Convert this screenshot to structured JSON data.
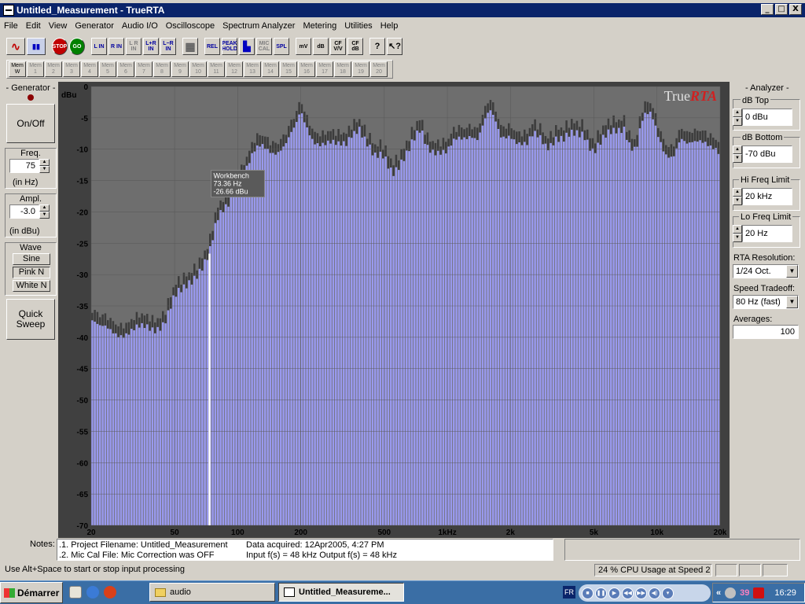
{
  "window": {
    "title": "Untitled_Measurement - TrueRTA",
    "controls": [
      "_",
      "□",
      "X"
    ]
  },
  "menu": [
    "File",
    "Edit",
    "View",
    "Generator",
    "Audio I/O",
    "Oscilloscope",
    "Spectrum Analyzer",
    "Metering",
    "Utilities",
    "Help"
  ],
  "toolbar": {
    "buttons": [
      {
        "name": "generator-wave-button",
        "label": "∿"
      },
      {
        "name": "spectrum-view-button",
        "label": "▮▮"
      },
      {
        "name": "stop-button",
        "label": "STOP"
      },
      {
        "name": "go-button",
        "label": "GO"
      },
      {
        "name": "l-in-button",
        "label": "L IN"
      },
      {
        "name": "r-in-button",
        "label": "R IN"
      },
      {
        "name": "l-r-in-button",
        "label": "L R IN"
      },
      {
        "name": "l-plus-r-in-button",
        "label": "L+R IN"
      },
      {
        "name": "l-minus-r-in-button",
        "label": "L−R IN"
      },
      {
        "name": "grid-button",
        "label": "▦"
      },
      {
        "name": "rel-button",
        "label": "REL"
      },
      {
        "name": "peak-hold-button",
        "label": "PEAK HOLD"
      },
      {
        "name": "bars-button",
        "label": "▙"
      },
      {
        "name": "mic-cal-button",
        "label": "MIC CAL"
      },
      {
        "name": "spl-button",
        "label": "SPL"
      },
      {
        "name": "mv-button",
        "label": "mV"
      },
      {
        "name": "db-button",
        "label": "dB"
      },
      {
        "name": "cf-vv-button",
        "label": "CF V/V"
      },
      {
        "name": "cf-db-button",
        "label": "CF dB"
      },
      {
        "name": "help-button",
        "label": "?"
      },
      {
        "name": "context-help-button",
        "label": "↖?"
      }
    ],
    "memories": [
      "Mem W",
      "Mem 1",
      "Mem 2",
      "Mem 3",
      "Mem 4",
      "Mem 5",
      "Mem 6",
      "Mem 7",
      "Mem 8",
      "Mem 9",
      "Mem 10",
      "Mem 11",
      "Mem 12",
      "Mem 13",
      "Mem 14",
      "Mem 15",
      "Mem 16",
      "Mem 17",
      "Mem 18",
      "Mem 19",
      "Mem 20"
    ]
  },
  "generator": {
    "title": "- Generator -",
    "on_off": "On/Off",
    "freq_label": "Freq.",
    "freq_value": "75",
    "freq_unit": "(in Hz)",
    "ampl_label": "Ampl.",
    "ampl_value": "-3.0",
    "ampl_unit": "(in dBu)",
    "wave_label": "Wave",
    "waves": [
      "Sine",
      "Pink N",
      "White N"
    ],
    "selected_wave": "Pink N",
    "quick_sweep": "Quick Sweep"
  },
  "analyzer": {
    "title": "- Analyzer -",
    "db_top_label": "dB Top",
    "db_top": "0 dBu",
    "db_bottom_label": "dB Bottom",
    "db_bottom": "-70 dBu",
    "hi_freq_label": "Hi Freq Limit",
    "hi_freq": "20 kHz",
    "lo_freq_label": "Lo Freq Limit",
    "lo_freq": "20 Hz",
    "resolution_label": "RTA Resolution:",
    "resolution": "1/24 Oct.",
    "speed_label": "Speed Tradeoff:",
    "speed": "80 Hz (fast)",
    "averages_label": "Averages:",
    "averages": "100"
  },
  "chart_data": {
    "type": "bar",
    "brand": "TrueRTA",
    "ylabel": "dBu",
    "ylim": [
      -70,
      0
    ],
    "yticks": [
      "0",
      "-5",
      "-10",
      "-15",
      "-20",
      "-25",
      "-30",
      "-35",
      "-40",
      "-45",
      "-50",
      "-55",
      "-60",
      "-65",
      "-70"
    ],
    "xscale": "log",
    "xlim": [
      20,
      20000
    ],
    "xticks": [
      {
        "v": 20,
        "label": "20"
      },
      {
        "v": 50,
        "label": "50"
      },
      {
        "v": 100,
        "label": "100"
      },
      {
        "v": 200,
        "label": "200"
      },
      {
        "v": 500,
        "label": "500"
      },
      {
        "v": 1000,
        "label": "1kHz"
      },
      {
        "v": 2000,
        "label": "2k"
      },
      {
        "v": 5000,
        "label": "5k"
      },
      {
        "v": 10000,
        "label": "10k"
      },
      {
        "v": 20000,
        "label": "20k"
      }
    ],
    "bar_color": "#9999ee",
    "peak_color": "#3c3c3c",
    "background": "#6e6e6e",
    "cursor": {
      "freq": 73.36,
      "series": "Workbench",
      "freq_label": "73.36 Hz",
      "level_label": "-26.66 dBu",
      "level": -26.66
    },
    "series": [
      {
        "name": "Workbench",
        "spectrum": [
          [
            20,
            -37
          ],
          [
            22,
            -39
          ],
          [
            25,
            -39
          ],
          [
            30,
            -39
          ],
          [
            35,
            -39
          ],
          [
            40,
            -38.5
          ],
          [
            45,
            -37
          ],
          [
            50,
            -34
          ],
          [
            55,
            -33
          ],
          [
            60,
            -31
          ],
          [
            65,
            -29
          ],
          [
            70,
            -27.5
          ],
          [
            73.36,
            -26.66
          ],
          [
            80,
            -22
          ],
          [
            90,
            -19
          ],
          [
            100,
            -15
          ],
          [
            110,
            -13
          ],
          [
            120,
            -11
          ],
          [
            130,
            -10
          ],
          [
            150,
            -10
          ],
          [
            170,
            -9
          ],
          [
            190,
            -7
          ],
          [
            200,
            -4.5
          ],
          [
            210,
            -6
          ],
          [
            230,
            -8
          ],
          [
            260,
            -9
          ],
          [
            300,
            -10
          ],
          [
            330,
            -9
          ],
          [
            350,
            -7
          ],
          [
            380,
            -6
          ],
          [
            410,
            -9
          ],
          [
            450,
            -12
          ],
          [
            500,
            -11
          ],
          [
            550,
            -13
          ],
          [
            600,
            -12
          ],
          [
            650,
            -11
          ],
          [
            700,
            -9
          ],
          [
            750,
            -7
          ],
          [
            800,
            -9
          ],
          [
            900,
            -10
          ],
          [
            1000,
            -11
          ],
          [
            1100,
            -9
          ],
          [
            1200,
            -8
          ],
          [
            1300,
            -7
          ],
          [
            1400,
            -8
          ],
          [
            1500,
            -6
          ],
          [
            1600,
            -4.5
          ],
          [
            1700,
            -6
          ],
          [
            1800,
            -8
          ],
          [
            2000,
            -7
          ],
          [
            2200,
            -9
          ],
          [
            2400,
            -10
          ],
          [
            2600,
            -8
          ],
          [
            2800,
            -8
          ],
          [
            3000,
            -9
          ],
          [
            3300,
            -8
          ],
          [
            3600,
            -9
          ],
          [
            4000,
            -8
          ],
          [
            4500,
            -7
          ],
          [
            5000,
            -10
          ],
          [
            5500,
            -9
          ],
          [
            6000,
            -8
          ],
          [
            6500,
            -7
          ],
          [
            7000,
            -6
          ],
          [
            7500,
            -9
          ],
          [
            8000,
            -10
          ],
          [
            8500,
            -6
          ],
          [
            9000,
            -5
          ],
          [
            9500,
            -5
          ],
          [
            10000,
            -7
          ],
          [
            11000,
            -10
          ],
          [
            12000,
            -11
          ],
          [
            13000,
            -9
          ],
          [
            14000,
            -10
          ],
          [
            15000,
            -9
          ],
          [
            16000,
            -8
          ],
          [
            17000,
            -8
          ],
          [
            18000,
            -9
          ],
          [
            19000,
            -10
          ],
          [
            20000,
            -11.5
          ]
        ],
        "peak_offset_db": 1.2
      }
    ]
  },
  "notes": {
    "label": "Notes:",
    "line1": ".1. Project Filename: Untitled_Measurement",
    "line2": ".2. Mic Cal File: Mic Correction was OFF",
    "acquired": "Data acquired: 12Apr2005, 4:27 PM",
    "sample_rates": "Input f(s) = 48 kHz   Output f(s) = 48 kHz"
  },
  "status": {
    "hint": "Use Alt+Space to start or stop input processing",
    "cpu": "24 % CPU Usage at Speed 2"
  },
  "taskbar": {
    "start": "Démarrer",
    "tasks": [
      "audio",
      "Untitled_Measureme..."
    ],
    "lang": "FR",
    "clock": "16:29",
    "tray_number": "39",
    "chevron": "«"
  }
}
